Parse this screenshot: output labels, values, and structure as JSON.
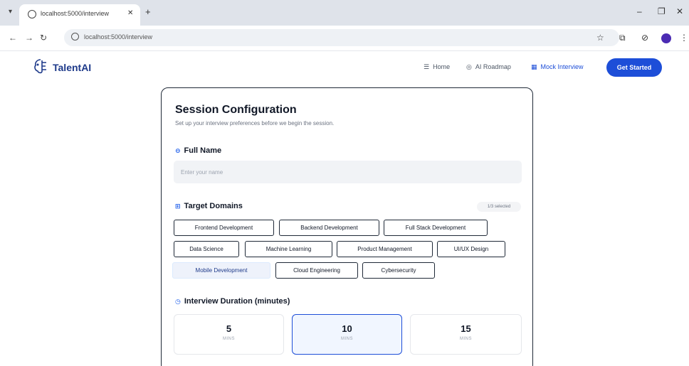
{
  "browser": {
    "tab_title": "localhost:5000/interview",
    "url": "localhost:5000/interview"
  },
  "header": {
    "logo_text": "TalentAI",
    "nav": [
      {
        "icon": "list-icon",
        "label": "Home"
      },
      {
        "icon": "target-icon",
        "label": "AI Roadmap"
      },
      {
        "icon": "grid-icon",
        "label": "Mock Interview"
      }
    ],
    "cta_label": "Get Started"
  },
  "session": {
    "title": "Session Configuration",
    "subtitle": "Set up your interview preferences before we begin the session.",
    "name_label": "Full Name",
    "name_placeholder": "Enter your name",
    "name_value": "",
    "domains_label": "Target Domains",
    "domains_count": "1/3 selected",
    "domains": [
      {
        "label": "Frontend Development",
        "selected": false
      },
      {
        "label": "Backend Development",
        "selected": false
      },
      {
        "label": "Full Stack Development",
        "selected": false
      },
      {
        "label": "Data Science",
        "selected": false
      },
      {
        "label": "Machine Learning",
        "selected": false
      },
      {
        "label": "Product Management",
        "selected": false
      },
      {
        "label": "UI/UX Design",
        "selected": false
      },
      {
        "label": "Mobile Development",
        "selected": true
      },
      {
        "label": "Cloud Engineering",
        "selected": false
      },
      {
        "label": "Cybersecurity",
        "selected": false
      }
    ],
    "duration_label": "Interview Duration (minutes)",
    "durations": [
      {
        "value": "5",
        "unit": "MINS",
        "selected": false
      },
      {
        "value": "10",
        "unit": "MINS",
        "selected": true
      },
      {
        "value": "15",
        "unit": "MINS",
        "selected": false
      }
    ]
  },
  "colors": {
    "accent": "#1d4ed8",
    "card_border": "#1f2937",
    "selected_chip_bg": "#eef2fb"
  }
}
